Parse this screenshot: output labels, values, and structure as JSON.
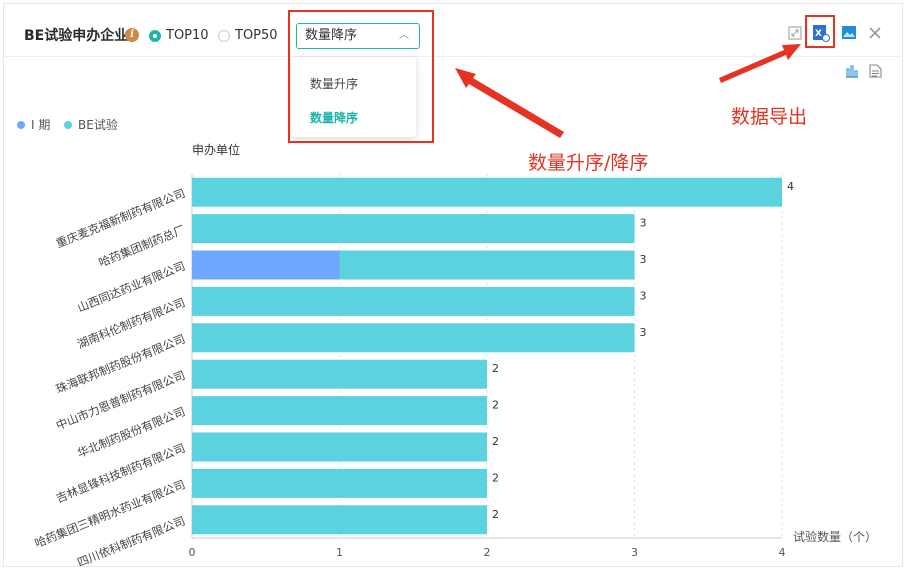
{
  "header": {
    "title": "BE试验申办企业",
    "info_icon": "i",
    "radios": [
      {
        "label": "TOP10",
        "checked": true
      },
      {
        "label": "TOP50",
        "checked": false
      }
    ],
    "sort_select": {
      "value": "数量降序"
    },
    "sort_options": [
      {
        "label": "数量升序",
        "active": false
      },
      {
        "label": "数量降序",
        "active": true
      }
    ]
  },
  "toolbar": {
    "icons": [
      "fullscreen-icon",
      "excel-export-icon",
      "image-export-icon",
      "close-icon"
    ],
    "view_icons": [
      "bar-chart-icon",
      "document-icon"
    ]
  },
  "annotations": {
    "sort_note": "数量升序/降序",
    "export_note": "数据导出"
  },
  "colors": {
    "accent": "#1db5a6",
    "series_phase1": "#6ea8fe",
    "series_be": "#5bd2de",
    "annotation": "#e53323"
  },
  "chart_data": {
    "type": "bar",
    "orientation": "horizontal",
    "stacked": true,
    "ylabel": "申办单位",
    "xlabel": "试验数量（个）",
    "xlim": [
      0,
      4
    ],
    "xticks": [
      "0",
      "1",
      "2",
      "3",
      "4"
    ],
    "legend": {
      "position": "top-left",
      "entries": [
        "I 期",
        "BE试验"
      ]
    },
    "categories": [
      "重庆麦克福新制药有限公司",
      "哈药集团制药总厂",
      "山西同达药业有限公司",
      "湖南科伦制药有限公司",
      "珠海联邦制药股份有限公司",
      "中山市力恩普制药有限公司",
      "华北制药股份有限公司",
      "吉林显锋科技制药有限公司",
      "哈药集团三精明水药业有限公司",
      "四川依科制药有限公司"
    ],
    "series": [
      {
        "name": "I 期",
        "values": [
          0,
          0,
          1,
          0,
          0,
          0,
          0,
          0,
          0,
          0
        ]
      },
      {
        "name": "BE试验",
        "values": [
          4,
          3,
          2,
          3,
          3,
          2,
          2,
          2,
          2,
          2
        ]
      }
    ],
    "totals": [
      "4",
      "3",
      "3",
      "3",
      "3",
      "2",
      "2",
      "2",
      "2",
      "2"
    ]
  }
}
